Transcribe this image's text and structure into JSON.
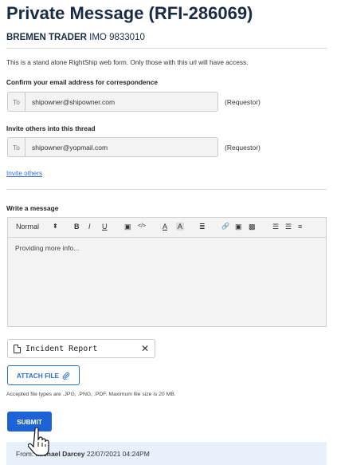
{
  "page": {
    "title": "Private Message (RFI-286069)",
    "vessel_name": "BREMEN TRADER",
    "vessel_imo": "IMO 9833010",
    "intro": "This is a stand alone RightShip web form. Only those with this url will have access."
  },
  "confirm": {
    "label": "Confirm your email address for correspondence",
    "prefix": "To",
    "email": "shipowner@shipowner.com",
    "role": "(Requestor)"
  },
  "invite": {
    "label": "Invite others into this thread",
    "prefix": "To",
    "email": "shipowner@yopmail.com",
    "role": "(Requestor)",
    "link": "Invite others"
  },
  "message": {
    "label": "Write a message",
    "style_select": "Normal",
    "style_arrows": "⬍",
    "toolbar": {
      "bold": "B",
      "italic": "I",
      "underline": "U",
      "image_glyph": "▣",
      "code": "</>",
      "font_color": "A",
      "bg_color": "A",
      "align": "≣",
      "link_glyph": "🔗",
      "media_glyph": "▣",
      "video_glyph": "▩",
      "ordered_list": "☰",
      "bullet_list": "☰",
      "indent": "≡"
    },
    "text": "Providing more info..."
  },
  "attachment": {
    "filename": "Incident Report",
    "remove_glyph": "✕",
    "attach_button": "ATTACH FILE",
    "clip_glyph": "⊘",
    "accepted_text": "Accepted file types are .JPG, .PNG, .PDF. Maximum file size is 20 MB."
  },
  "submit": {
    "label": "SUBMIT"
  },
  "history": {
    "from_label": "From:",
    "name": "Michael Darcey",
    "datetime": "22/07/2021 04:24PM"
  },
  "icons": {
    "document": "document-icon",
    "close": "close-icon",
    "paperclip": "paperclip-icon",
    "pointer": "hand-pointer-icon"
  },
  "colors": {
    "title": "#1a2b44",
    "accent": "#1e63d6",
    "link": "#2c6fd1",
    "history_bg": "#e8f1fb"
  }
}
